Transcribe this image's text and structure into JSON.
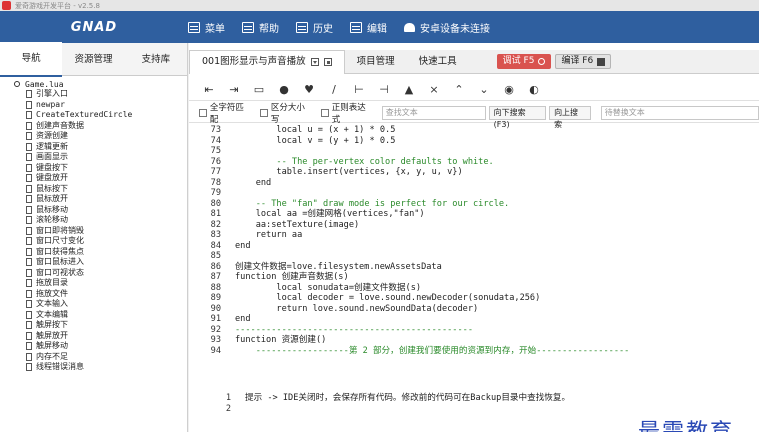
{
  "titlebar": {
    "text": "爱奇游戏开发平台 - v2.5.8"
  },
  "menubar": {
    "brand": "GNAD",
    "items": [
      "菜单",
      "帮助",
      "历史",
      "编辑"
    ],
    "device": "安卓设备未连接"
  },
  "left_tabs": [
    "导航",
    "资源管理",
    "支持库"
  ],
  "tree": {
    "root": "Game.lua",
    "items": [
      "引擎入口",
      "newpar",
      "CreateTexturedCircle",
      "创建声音数据",
      "资源创建",
      "逻辑更新",
      "画面显示",
      "键盘按下",
      "键盘放开",
      "鼠标按下",
      "鼠标放开",
      "鼠标移动",
      "滚轮移动",
      "窗口即将销毁",
      "窗口尺寸变化",
      "窗口获得焦点",
      "窗口鼠标进入",
      "窗口可视状态",
      "拖放目录",
      "拖放文件",
      "文本输入",
      "文本编辑",
      "触屏按下",
      "触屏放开",
      "触屏移动",
      "内存不足",
      "线程错误消息"
    ]
  },
  "tabs": {
    "active": "001图形显示与声音播放",
    "others": [
      "项目管理",
      "快速工具"
    ],
    "debug": "调试 F5",
    "compile": "编译 F6"
  },
  "toolbar_icons": [
    "indent-left-icon",
    "indent-right-icon",
    "folder-icon",
    "marker-icon",
    "heart-icon",
    "brush-icon",
    "align-left-icon",
    "align-right-icon",
    "bell-icon",
    "bell-off-icon",
    "chevron-up-icon",
    "chevron-down-icon",
    "eye-icon",
    "view-icon"
  ],
  "search": {
    "opts": [
      "全字符匹配",
      "区分大小写",
      "正则表达式"
    ],
    "placeholder": "查找文本",
    "down": "向下搜索(F3)",
    "up": "向上搜索",
    "replace_placeholder": "待替换文本"
  },
  "code_lines": [
    {
      "n": "73",
      "t": "        local u = (x + 1) * 0.5"
    },
    {
      "n": "74",
      "t": "        local v = (y + 1) * 0.5"
    },
    {
      "n": "75",
      "t": ""
    },
    {
      "n": "76",
      "t": "        -- The per-vertex color defaults to white."
    },
    {
      "n": "77",
      "t": "        table.insert(vertices, {x, y, u, v})"
    },
    {
      "n": "78",
      "t": "    end"
    },
    {
      "n": "79",
      "t": ""
    },
    {
      "n": "80",
      "t": "    -- The \"fan\" draw mode is perfect for our circle."
    },
    {
      "n": "81",
      "t": "    local aa =创建网格(vertices,\"fan\")"
    },
    {
      "n": "82",
      "t": "    aa:setTexture(image)"
    },
    {
      "n": "83",
      "t": "    return aa"
    },
    {
      "n": "84",
      "t": "end"
    },
    {
      "n": "85",
      "t": ""
    },
    {
      "n": "86",
      "t": "创建文件数据=love.filesystem.newAssetsData"
    },
    {
      "n": "87",
      "t": "function 创建声音数据(s)"
    },
    {
      "n": "88",
      "t": "        local sonudata=创建文件数据(s)"
    },
    {
      "n": "89",
      "t": "        local decoder = love.sound.newDecoder(sonudata,256)"
    },
    {
      "n": "90",
      "t": "        return love.sound.newSoundData(decoder)"
    },
    {
      "n": "91",
      "t": "end"
    },
    {
      "n": "92",
      "t": "----------------------------------------------"
    },
    {
      "n": "93",
      "t": "function 资源创建()"
    },
    {
      "n": "94",
      "t": "    ------------------第 2 部分，创建我们要使用的资源到内存，开始------------------"
    }
  ],
  "console_lines": [
    {
      "n": "1",
      "t": "提示 -> IDE关闭时，会保存所有代码。修改前的代码可在Backup目录中查找恢复。"
    },
    {
      "n": "2",
      "t": ""
    }
  ],
  "watermark": "最需教育",
  "colors": {
    "menubar": "#2f5f9f",
    "debug_button": "#d9534f",
    "keyword": "#1e4fa8",
    "comment": "#2a8a2a",
    "string": "#b0208f"
  }
}
